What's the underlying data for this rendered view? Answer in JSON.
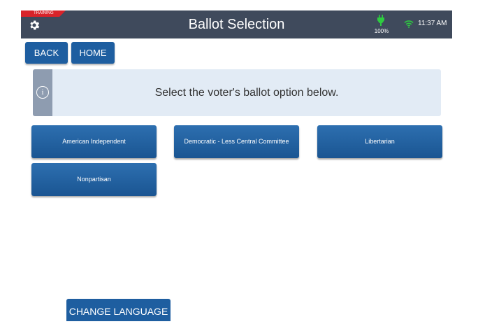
{
  "header": {
    "training_label": "TRAINING",
    "title": "Ballot Selection",
    "battery_level": "100%",
    "time": "11:37 AM",
    "icons": {
      "settings": "gear-icon",
      "battery": "battery-plug-icon",
      "wifi": "wifi-icon"
    },
    "colors": {
      "header_bg": "#3f4a5c",
      "training_badge": "#d8232a",
      "status_green": "#2ecc40"
    }
  },
  "nav": {
    "back_label": "BACK",
    "home_label": "HOME"
  },
  "info": {
    "icon": "info-icon",
    "icon_glyph": "i",
    "message": "Select the voter's ballot option below."
  },
  "ballot_options": [
    {
      "label": "American Independent"
    },
    {
      "label": "Democratic - Less Central Committee"
    },
    {
      "label": "Libertarian"
    },
    {
      "label": "Nonpartisan"
    }
  ],
  "footer": {
    "change_language_label": "CHANGE LANGUAGE"
  },
  "colors": {
    "primary_button": "#1e5ea0",
    "info_background": "#e2ebf5"
  }
}
